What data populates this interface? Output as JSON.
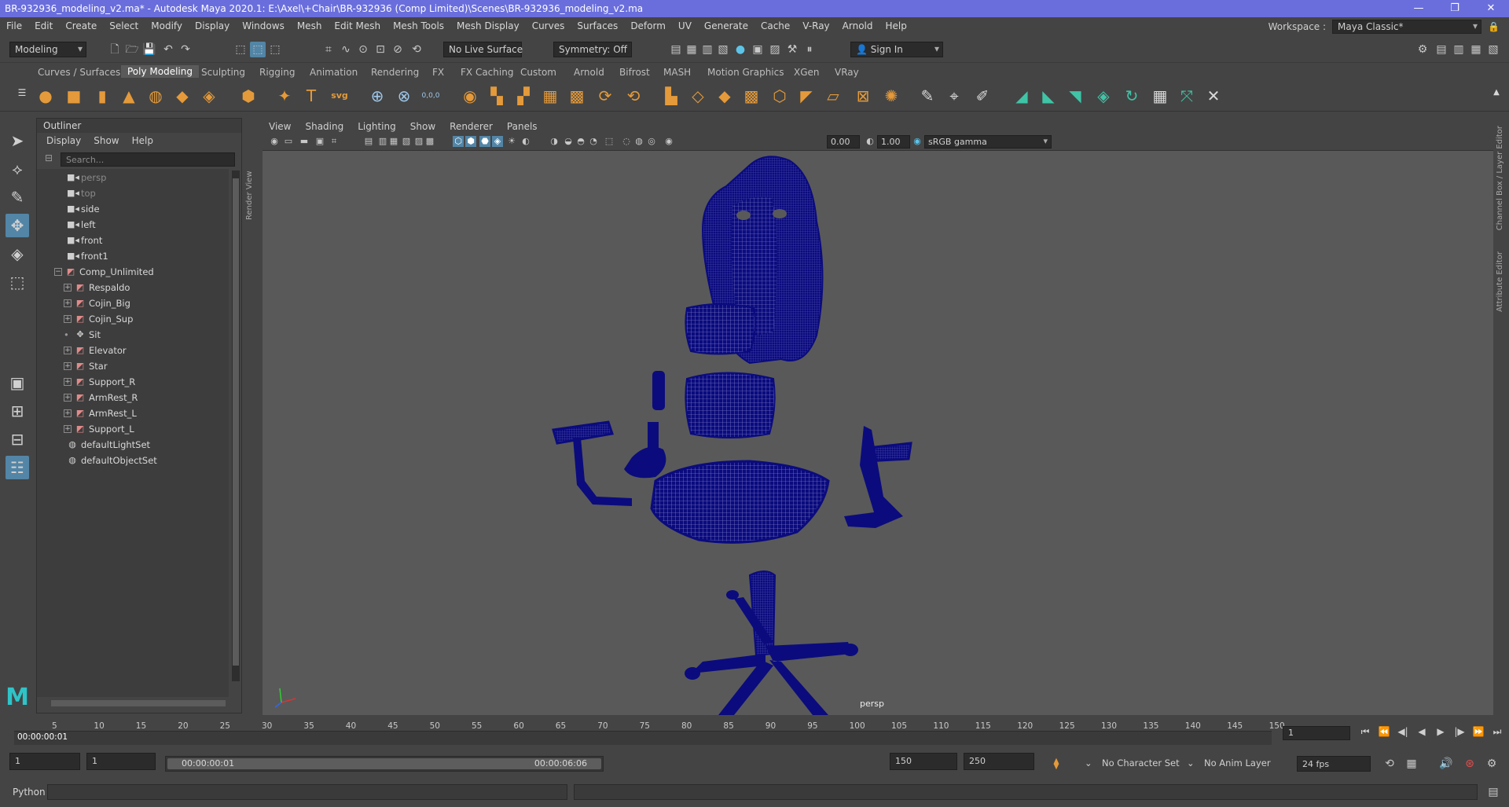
{
  "window": {
    "title": "BR-932936_modeling_v2.ma* - Autodesk Maya 2020.1: E:\\Axel\\+Chair\\BR-932936 (Comp Limited)\\Scenes\\BR-932936_modeling_v2.ma"
  },
  "menu": [
    "File",
    "Edit",
    "Create",
    "Select",
    "Modify",
    "Display",
    "Windows",
    "Mesh",
    "Edit Mesh",
    "Mesh Tools",
    "Mesh Display",
    "Curves",
    "Surfaces",
    "Deform",
    "UV",
    "Generate",
    "Cache",
    "V-Ray",
    "Arnold",
    "Help"
  ],
  "workspace": {
    "label": "Workspace :",
    "value": "Maya Classic*"
  },
  "status": {
    "menuset": "Modeling",
    "live_surface": "No Live Surface",
    "symmetry": "Symmetry: Off",
    "sign_in": "Sign In"
  },
  "shelf_tabs": [
    "Curves / Surfaces",
    "Poly Modeling",
    "Sculpting",
    "Rigging",
    "Animation",
    "Rendering",
    "FX",
    "FX Caching",
    "Custom",
    "Arnold",
    "Bifrost",
    "MASH",
    "Motion Graphics",
    "XGen",
    "VRay"
  ],
  "shelf_active": "Poly Modeling",
  "shelf_svg_label": "svg",
  "shelf_coord_label": "0,0,0",
  "outliner": {
    "title": "Outliner",
    "menu": [
      "Display",
      "Show",
      "Help"
    ],
    "search_placeholder": "Search...",
    "items": [
      {
        "label": "persp",
        "kind": "camera",
        "dim": true
      },
      {
        "label": "top",
        "kind": "camera",
        "dim": true
      },
      {
        "label": "side",
        "kind": "camera"
      },
      {
        "label": "left",
        "kind": "camera"
      },
      {
        "label": "front",
        "kind": "camera"
      },
      {
        "label": "front1",
        "kind": "camera"
      },
      {
        "label": "Comp_Unlimited",
        "kind": "group"
      },
      {
        "label": "Respaldo",
        "kind": "mesh"
      },
      {
        "label": "Cojin_Big",
        "kind": "mesh"
      },
      {
        "label": "Cojin_Sup",
        "kind": "mesh"
      },
      {
        "label": "Sit",
        "kind": "locator"
      },
      {
        "label": "Elevator",
        "kind": "mesh"
      },
      {
        "label": "Star",
        "kind": "mesh"
      },
      {
        "label": "Support_R",
        "kind": "mesh"
      },
      {
        "label": "ArmRest_R",
        "kind": "mesh"
      },
      {
        "label": "ArmRest_L",
        "kind": "mesh"
      },
      {
        "label": "Support_L",
        "kind": "mesh"
      },
      {
        "label": "defaultLightSet",
        "kind": "set"
      },
      {
        "label": "defaultObjectSet",
        "kind": "set"
      }
    ]
  },
  "render_view_tab": "Render View",
  "viewport": {
    "menu": [
      "View",
      "Shading",
      "Lighting",
      "Show",
      "Renderer",
      "Panels"
    ],
    "exposure": "0.00",
    "gamma": "1.00",
    "color_space": "sRGB gamma",
    "camera": "persp",
    "wire_color": "#0b0b7e"
  },
  "side_tabs": [
    "Channel Box / Layer Editor",
    "Attribute Editor"
  ],
  "timeline": {
    "ticks": [
      "5",
      "10",
      "15",
      "20",
      "25",
      "30",
      "35",
      "40",
      "45",
      "50",
      "55",
      "60",
      "65",
      "70",
      "75",
      "80",
      "85",
      "90",
      "95",
      "100",
      "105",
      "110",
      "115",
      "120",
      "125",
      "130",
      "135",
      "140",
      "145",
      "150"
    ],
    "current_time": "00:00:00:01",
    "current_frame": "1"
  },
  "range": {
    "start": "1",
    "anim_start": "1",
    "slider_left": "00:00:00:01",
    "slider_right": "00:00:06:06",
    "end": "150",
    "anim_end": "250",
    "character_set": "No Character Set",
    "anim_layer": "No Anim Layer",
    "fps": "24 fps"
  },
  "cmd": {
    "language": "Python"
  }
}
